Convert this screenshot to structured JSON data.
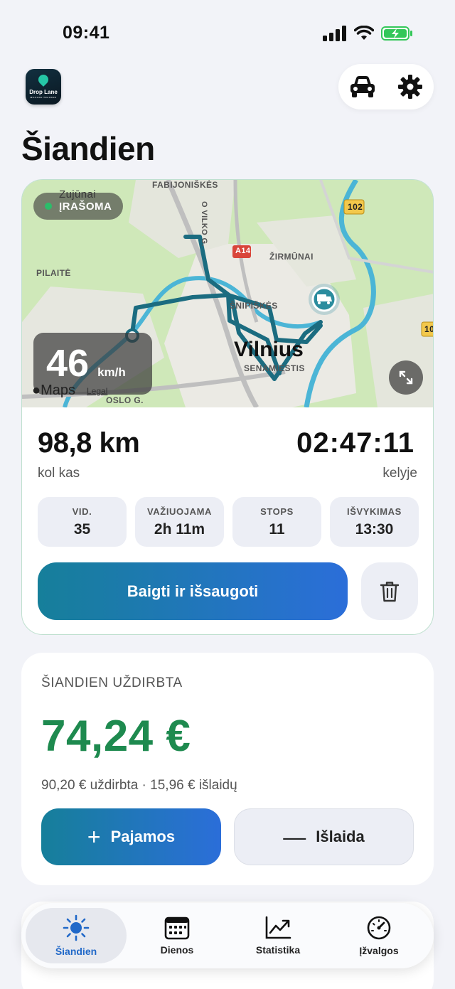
{
  "status_bar": {
    "time": "09:41"
  },
  "app": {
    "logo_name": "Drop Lane",
    "logo_tagline": "MILEAGE TRACKER"
  },
  "header": {
    "title": "Šiandien",
    "vehicle_icon": "car-icon",
    "settings_icon": "gear-icon"
  },
  "map": {
    "recording_label": "ĮRAŠOMA",
    "place_labels": [
      "Zujūnai",
      "FABIJONIŠKĖS",
      "ŽIRMŪNAI",
      "PILAITĖ",
      "ŠNIPIŠKĖS",
      "Vilnius",
      "SENAMIESTIS",
      "OSLO G.",
      "O VILKO G."
    ],
    "road_badges": [
      "102",
      "A14",
      "10"
    ],
    "speed_value": "46",
    "speed_unit": "km/h",
    "maps_credit": "Maps",
    "legal": "Legal"
  },
  "trip": {
    "distance": "98,8 km",
    "distance_caption": "kol kas",
    "duration": "02:47:11",
    "duration_caption": "kelyje",
    "stats": [
      {
        "label": "VID.",
        "value": "35"
      },
      {
        "label": "VAŽIUOJAMA",
        "value": "2h 11m"
      },
      {
        "label": "STOPS",
        "value": "11"
      },
      {
        "label": "IŠVYKIMAS",
        "value": "13:30"
      }
    ],
    "finish_label": "Baigti ir išsaugoti"
  },
  "earnings": {
    "label": "ŠIANDIEN UŽDIRBTA",
    "value": "74,24 €",
    "detail": "90,20 € uždirbta · 15,96 € išlaidų",
    "income_label": "Pajamos",
    "expense_label": "Išlaida"
  },
  "tabs": [
    {
      "label": "Šiandien",
      "icon": "sun-icon",
      "active": true
    },
    {
      "label": "Dienos",
      "icon": "calendar-icon",
      "active": false
    },
    {
      "label": "Statistika",
      "icon": "chart-icon",
      "active": false
    },
    {
      "label": "Įžvalgos",
      "icon": "gauge-icon",
      "active": false
    }
  ],
  "colors": {
    "accent": "#2068c8",
    "earnings_green": "#1e8a4f",
    "route": "#1b6c80"
  }
}
